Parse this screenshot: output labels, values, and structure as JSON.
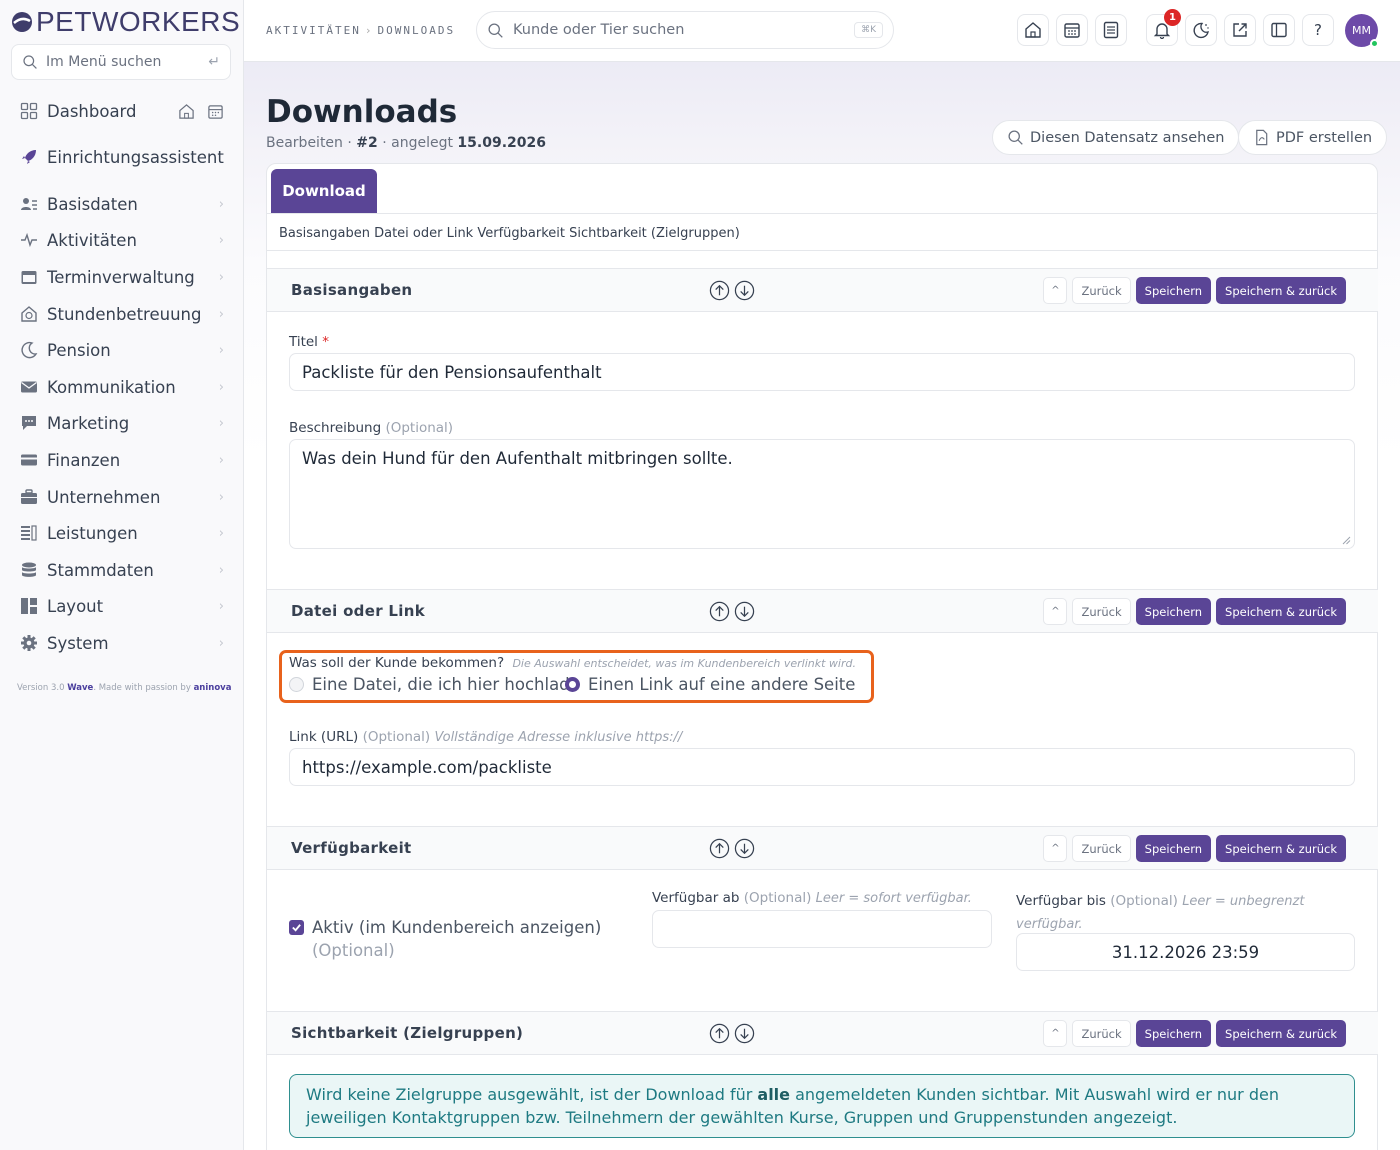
{
  "brand": {
    "name": "PETWORKERS"
  },
  "sidebar": {
    "search_placeholder": "Im Menü suchen",
    "enter_symbol": "↵",
    "items": [
      {
        "label": "Dashboard",
        "icon": "grid-icon"
      },
      {
        "label": "Einrichtungsassistent",
        "icon": "rocket-icon"
      },
      {
        "label": "Basisdaten",
        "icon": "users-list-icon"
      },
      {
        "label": "Aktivitäten",
        "icon": "activity-icon"
      },
      {
        "label": "Terminverwaltung",
        "icon": "calendar-icon"
      },
      {
        "label": "Stundenbetreuung",
        "icon": "house-clock-icon"
      },
      {
        "label": "Pension",
        "icon": "moon-icon"
      },
      {
        "label": "Kommunikation",
        "icon": "envelope-icon"
      },
      {
        "label": "Marketing",
        "icon": "chat-icon"
      },
      {
        "label": "Finanzen",
        "icon": "credit-card-icon"
      },
      {
        "label": "Unternehmen",
        "icon": "briefcase-icon"
      },
      {
        "label": "Leistungen",
        "icon": "list-icon"
      },
      {
        "label": "Stammdaten",
        "icon": "database-icon"
      },
      {
        "label": "Layout",
        "icon": "layout-icon"
      },
      {
        "label": "System",
        "icon": "gear-icon"
      }
    ],
    "chevron": "›",
    "version_text": "Version 3.0",
    "version_name": "Wave",
    "made_with": ". Made with passion by",
    "made_by": "aninova"
  },
  "topbar": {
    "breadcrumb": [
      "AKTIVITÄTEN",
      "DOWNLOADS"
    ],
    "breadcrumb_sep": "›",
    "search_placeholder": "Kunde oder Tier suchen",
    "search_kbd": "⌘K",
    "notification_count": "1",
    "help": "?",
    "avatar_initials": "MM"
  },
  "page": {
    "title": "Downloads",
    "sub_edit": "Bearbeiten",
    "sub_id": "#2",
    "sub_created": "angelegt",
    "sub_date": "15.09.2026",
    "view_button": "Diesen Datensatz ansehen",
    "pdf_button": "PDF erstellen",
    "tab": "Download",
    "anchors": "Basisangaben Datei oder Link Verfügbarkeit Sichtbarkeit (Zielgruppen)"
  },
  "section_buttons": {
    "up": "^",
    "back": "Zurück",
    "save": "Speichern",
    "save_back": "Speichern & zurück"
  },
  "sections": {
    "basis": {
      "title": "Basisangaben",
      "title_label": "Titel",
      "required_mark": "*",
      "title_value": "Packliste für den Pensionsaufenthalt",
      "desc_label": "Beschreibung",
      "desc_optional": "(Optional)",
      "desc_value": "Was dein Hund für den Aufenthalt mitbringen sollte."
    },
    "file": {
      "title": "Datei oder Link",
      "question": "Was soll der Kunde bekommen?",
      "question_hint": "Die Auswahl entscheidet, was im Kundenbereich verlinkt wird.",
      "option_file": "Eine Datei, die ich hier hochlade",
      "option_link": "Einen Link auf eine andere Seite",
      "link_label": "Link (URL)",
      "link_optional": "(Optional)",
      "link_hint": "Vollständige Adresse inklusive https://",
      "link_value": "https://example.com/packliste"
    },
    "availability": {
      "title": "Verfügbarkeit",
      "active_label": "Aktiv (im Kundenbereich anzeigen)",
      "active_optional": "(Optional)",
      "from_label": "Verfügbar ab",
      "from_optional": "(Optional)",
      "from_hint": "Leer = sofort verfügbar.",
      "from_value": "",
      "to_label": "Verfügbar bis",
      "to_optional": "(Optional)",
      "to_hint": "Leer = unbegrenzt verfügbar.",
      "to_value": "31.12.2026 23:59"
    },
    "visibility": {
      "title": "Sichtbarkeit (Zielgruppen)",
      "info_pre": "Wird keine Zielgruppe ausgewählt, ist der Download für",
      "info_bold": "alle",
      "info_post": "angemeldeten Kunden sichtbar. Mit Auswahl wird er nur den jeweiligen Kontaktgruppen bzw. Teilnehmern der gewählten Kurse, Gruppen und Gruppenstunden angezeigt."
    }
  },
  "colors": {
    "accent": "#5a4596",
    "highlight": "#e8621c",
    "info": "#1e7a82"
  }
}
